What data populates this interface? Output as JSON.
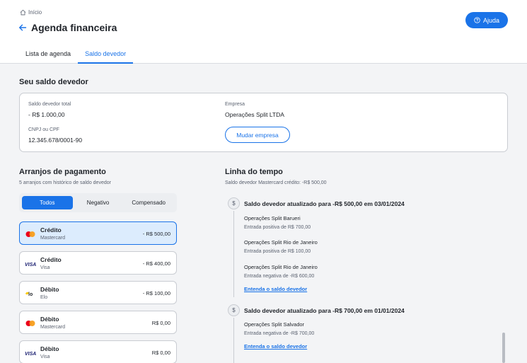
{
  "header": {
    "breadcrumb": "Início",
    "title": "Agenda financeira",
    "help_label": "Ajuda",
    "tabs": [
      {
        "label": "Lista de agenda",
        "active": false
      },
      {
        "label": "Saldo devedor",
        "active": true
      }
    ]
  },
  "summary": {
    "title": "Seu saldo devedor",
    "total_label": "Saldo devedor total",
    "total_value": "- R$ 1.000,00",
    "doc_label": "CNPJ ou CPF",
    "doc_value": "12.345.678/0001-90",
    "company_label": "Empresa",
    "company_value": "Operações Split LTDA",
    "change_label": "Mudar empresa"
  },
  "arrangements": {
    "title": "Arranjos de pagamento",
    "subtitle": "5 arranjos com histórico de saldo devedor",
    "filters": [
      "Todos",
      "Negativo",
      "Compensado"
    ],
    "active_filter": "Todos",
    "items": [
      {
        "name": "Crédito",
        "brand": "Mastercard",
        "brand_icon": "mastercard-icon",
        "amount": "- R$ 500,00",
        "selected": true
      },
      {
        "name": "Crédito",
        "brand": "Visa",
        "brand_icon": "visa-icon",
        "amount": "- R$ 400,00",
        "selected": false
      },
      {
        "name": "Débito",
        "brand": "Elo",
        "brand_icon": "elo-icon",
        "amount": "- R$ 100,00",
        "selected": false
      },
      {
        "name": "Débito",
        "brand": "Mastercard",
        "brand_icon": "mastercard-icon",
        "amount": "R$ 0,00",
        "selected": false
      },
      {
        "name": "Débito",
        "brand": "Visa",
        "brand_icon": "visa-icon",
        "amount": "R$ 0,00",
        "selected": false
      }
    ]
  },
  "timeline": {
    "title": "Linha do tempo",
    "subtitle": "Saldo devedor Mastercard crédito: -R$ 500,00",
    "events": [
      {
        "heading": "Saldo devedor atualizado para -R$ 500,00 em 03/01/2024",
        "entries": [
          {
            "title": "Operações Split Barueri",
            "desc": "Entrada positiva de R$ 700,00"
          },
          {
            "title": "Operações Split Rio de Janeiro",
            "desc": "Entrada positiva de R$ 100,00"
          },
          {
            "title": "Operações Split Rio de Janeiro",
            "desc": "Entrada negativa de -R$ 600,00"
          }
        ],
        "link": "Entenda o saldo devedor"
      },
      {
        "heading": "Saldo devedor atualizado para -R$ 700,00 em 01/01/2024",
        "entries": [
          {
            "title": "Operações Split Salvador",
            "desc": "Entrada negativa de -R$ 700,00"
          }
        ],
        "link": "Entenda o saldo devedor"
      }
    ]
  },
  "colors": {
    "accent": "#1a73e8",
    "selected_bg": "#dcecfd",
    "mastercard_red": "#eb001b",
    "mastercard_orange": "#f79e1b",
    "visa_blue": "#1a1f71"
  }
}
